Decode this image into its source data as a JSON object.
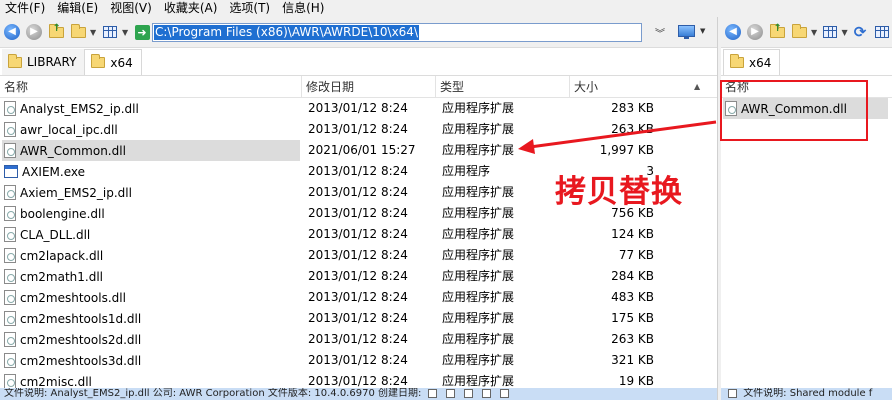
{
  "menubar": {
    "items": [
      "文件(F)",
      "编辑(E)",
      "视图(V)",
      "收藏夹(A)",
      "选项(T)",
      "信息(H)"
    ]
  },
  "left_pane": {
    "address": "C:\\Program Files (x86)\\AWR\\AWRDE\\10\\x64\\",
    "tabs": [
      {
        "label": "LIBRARY",
        "active": false
      },
      {
        "label": "x64",
        "active": true
      }
    ],
    "columns": [
      "名称",
      "修改日期",
      "类型",
      "大小"
    ],
    "files": [
      {
        "name": "Analyst_EMS2_ip.dll",
        "date": "2013/01/12 8:24",
        "type": "应用程序扩展",
        "size": "283 KB",
        "icon": "dll-file-icon",
        "selected": false
      },
      {
        "name": "awr_local_ipc.dll",
        "date": "2013/01/12 8:24",
        "type": "应用程序扩展",
        "size": "263 KB",
        "icon": "dll-file-icon",
        "selected": false
      },
      {
        "name": "AWR_Common.dll",
        "date": "2021/06/01 15:27",
        "type": "应用程序扩展",
        "size": "1,997 KB",
        "icon": "dll-file-icon",
        "selected": true
      },
      {
        "name": "AXIEM.exe",
        "date": "2013/01/12 8:24",
        "type": "应用程序",
        "size": "3",
        "icon": "exe-file-icon",
        "selected": false
      },
      {
        "name": "Axiem_EMS2_ip.dll",
        "date": "2013/01/12 8:24",
        "type": "应用程序扩展",
        "size": "",
        "icon": "dll-file-icon",
        "selected": false
      },
      {
        "name": "boolengine.dll",
        "date": "2013/01/12 8:24",
        "type": "应用程序扩展",
        "size": "756 KB",
        "icon": "dll-file-icon",
        "selected": false
      },
      {
        "name": "CLA_DLL.dll",
        "date": "2013/01/12 8:24",
        "type": "应用程序扩展",
        "size": "124 KB",
        "icon": "dll-file-icon",
        "selected": false
      },
      {
        "name": "cm2lapack.dll",
        "date": "2013/01/12 8:24",
        "type": "应用程序扩展",
        "size": "77 KB",
        "icon": "dll-file-icon",
        "selected": false
      },
      {
        "name": "cm2math1.dll",
        "date": "2013/01/12 8:24",
        "type": "应用程序扩展",
        "size": "284 KB",
        "icon": "dll-file-icon",
        "selected": false
      },
      {
        "name": "cm2meshtools.dll",
        "date": "2013/01/12 8:24",
        "type": "应用程序扩展",
        "size": "483 KB",
        "icon": "dll-file-icon",
        "selected": false
      },
      {
        "name": "cm2meshtools1d.dll",
        "date": "2013/01/12 8:24",
        "type": "应用程序扩展",
        "size": "175 KB",
        "icon": "dll-file-icon",
        "selected": false
      },
      {
        "name": "cm2meshtools2d.dll",
        "date": "2013/01/12 8:24",
        "type": "应用程序扩展",
        "size": "263 KB",
        "icon": "dll-file-icon",
        "selected": false
      },
      {
        "name": "cm2meshtools3d.dll",
        "date": "2013/01/12 8:24",
        "type": "应用程序扩展",
        "size": "321 KB",
        "icon": "dll-file-icon",
        "selected": false
      },
      {
        "name": "cm2misc.dll",
        "date": "2013/01/12 8:24",
        "type": "应用程序扩展",
        "size": "19 KB",
        "icon": "dll-file-icon",
        "selected": false
      }
    ],
    "status": "文件说明: Analyst_EMS2_ip.dll 公司: AWR Corporation 文件版本: 10.4.0.6970 创建日期:"
  },
  "right_pane": {
    "tabs": [
      {
        "label": "x64",
        "active": true
      }
    ],
    "columns": [
      "名称"
    ],
    "files": [
      {
        "name": "AWR_Common.dll",
        "icon": "dll-file-icon",
        "selected": true
      }
    ],
    "status": "文件说明: Shared module f"
  },
  "annotation": {
    "text": "拷贝替换",
    "color": "#e8181f"
  },
  "colors": {
    "address_highlight": "#1f6fd1",
    "statusbar": "#c9ddf5",
    "selection": "#dcdcdc"
  }
}
